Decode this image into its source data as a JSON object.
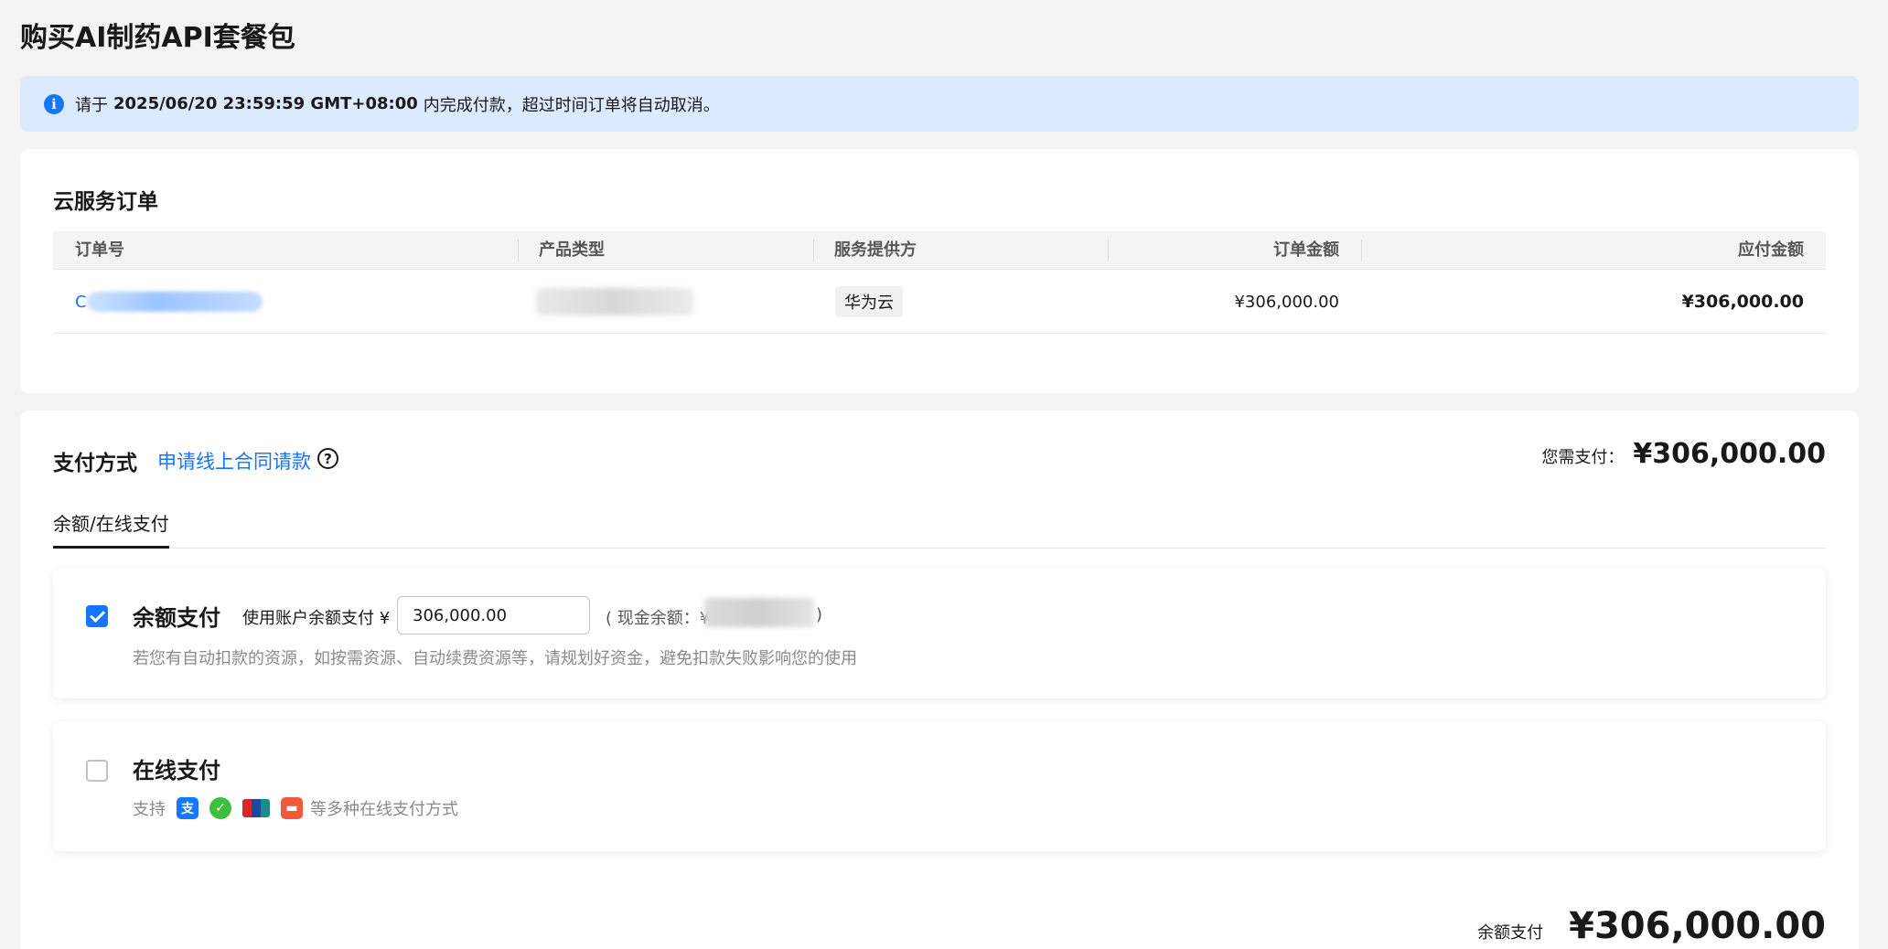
{
  "page": {
    "title": "购买AI制药API套餐包"
  },
  "notice": {
    "prefix": "请于",
    "deadline": "2025/06/20 23:59:59 GMT+08:00",
    "suffix": "内完成付款，超过时间订单将自动取消。"
  },
  "order": {
    "section_title": "云服务订单",
    "columns": [
      "订单号",
      "产品类型",
      "服务提供方",
      "订单金额",
      "应付金额"
    ],
    "rows": [
      {
        "order_no_prefix": "C",
        "provider": "华为云",
        "order_amount": "¥306,000.00",
        "payable_amount": "¥306,000.00"
      }
    ]
  },
  "payment": {
    "section_title": "支付方式",
    "contract_link": "申请线上合同请款",
    "need_pay_label": "您需支付：",
    "need_pay_amount": "¥306,000.00",
    "tabs": [
      {
        "label": "余额/在线支付",
        "active": true
      }
    ],
    "balance": {
      "title": "余额支付",
      "checked": true,
      "use_label": "使用账户余额支付 ¥",
      "input_value": "306,000.00",
      "cash_label": "( 现金余额：¥",
      "cash_close": ")",
      "hint": "若您有自动扣款的资源，如按需资源、自动续费资源等，请规划好资金，避免扣款失败影响您的使用"
    },
    "online": {
      "title": "在线支付",
      "checked": false,
      "support_label": "支持",
      "methods": [
        "alipay-icon",
        "wechat-pay-icon",
        "unionpay-icon",
        "card-pay-icon"
      ],
      "tail_label": "等多种在线支付方式"
    },
    "final_label": "余额支付",
    "final_amount": "¥306,000.00"
  },
  "colors": {
    "accent": "#1476ff",
    "notice_bg": "#dbeafe",
    "page_bg": "#f4f4f4"
  }
}
